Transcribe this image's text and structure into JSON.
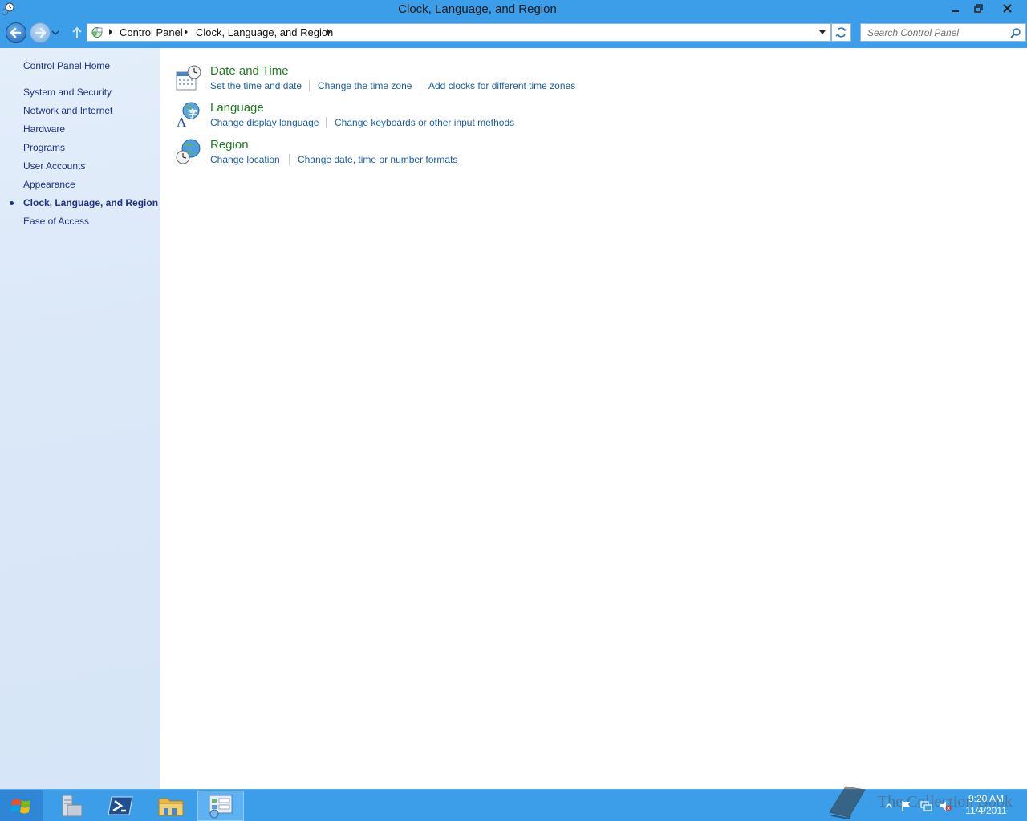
{
  "window": {
    "title": "Clock, Language, and Region"
  },
  "address": {
    "breadcrumbs": [
      "Control Panel",
      "Clock, Language, and Region"
    ]
  },
  "search": {
    "placeholder": "Search Control Panel"
  },
  "sidebar": {
    "home": "Control Panel Home",
    "items": [
      {
        "label": "System and Security"
      },
      {
        "label": "Network and Internet"
      },
      {
        "label": "Hardware"
      },
      {
        "label": "Programs"
      },
      {
        "label": "User Accounts"
      },
      {
        "label": "Appearance"
      },
      {
        "label": "Clock, Language, and Region",
        "active": true
      },
      {
        "label": "Ease of Access"
      }
    ]
  },
  "categories": [
    {
      "title": "Date and Time",
      "icon": "calendar-clock-icon",
      "links": [
        "Set the time and date",
        "Change the time zone",
        "Add clocks for different time zones"
      ]
    },
    {
      "title": "Language",
      "icon": "language-globe-icon",
      "links": [
        "Change display language",
        "Change keyboards or other input methods"
      ]
    },
    {
      "title": "Region",
      "icon": "region-globe-clock-icon",
      "links": [
        "Change location",
        "Change date, time or number formats"
      ]
    }
  ],
  "taskbar": {
    "apps": [
      "server-manager-icon",
      "powershell-icon",
      "file-explorer-icon",
      "control-panel-icon"
    ],
    "watermark": "The Collection Book",
    "clock": {
      "time": "9:20 AM",
      "date": "11/4/2011"
    }
  },
  "colors": {
    "accent": "#3c9ee8",
    "link": "#1a5ea8",
    "category_title": "#1e7b1e",
    "sidebar_link": "#1e3287"
  }
}
